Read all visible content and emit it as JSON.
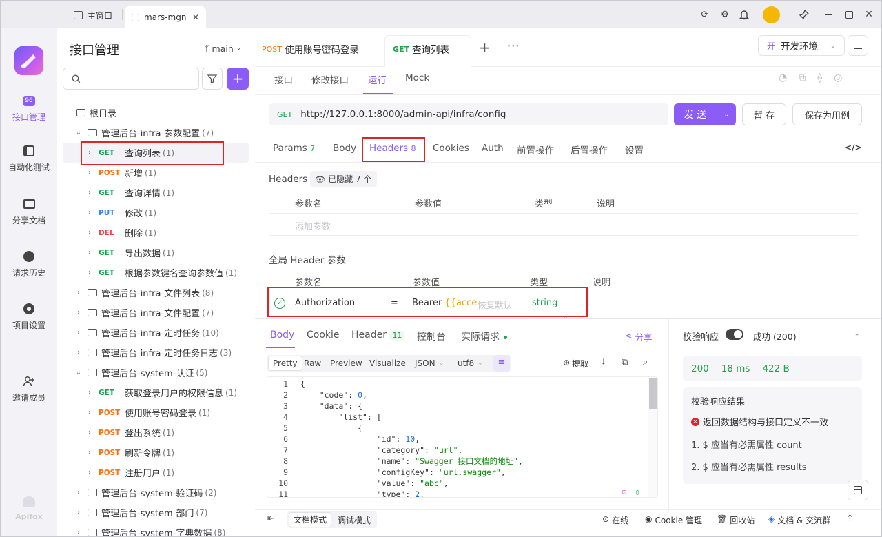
{
  "window": {
    "tabs": [
      {
        "label": "主窗口",
        "icon": "home-icon"
      },
      {
        "label": "mars-mgn",
        "icon": "external-icon",
        "close": "✕"
      }
    ]
  },
  "rail": {
    "items": [
      {
        "label": "接口管理",
        "icon": "api-icon",
        "active": true
      },
      {
        "label": "自动化测试",
        "icon": "automation-icon"
      },
      {
        "label": "分享文档",
        "icon": "book-icon"
      },
      {
        "label": "请求历史",
        "icon": "history-icon"
      },
      {
        "label": "项目设置",
        "icon": "settings-icon"
      },
      {
        "label": "邀请成员",
        "icon": "invite-icon"
      }
    ],
    "brand": "Apifox"
  },
  "tree": {
    "title": "接口管理",
    "branch": "main",
    "search_placeholder": "",
    "root": "根目录",
    "rows": [
      {
        "type": "folder",
        "label": "管理后台-infra-参数配置",
        "count": "(7)",
        "expanded": true,
        "indent": 0
      },
      {
        "type": "api",
        "method": "GET",
        "label": "查询列表",
        "count": "(1)",
        "selected": true
      },
      {
        "type": "api",
        "method": "POST",
        "label": "新增",
        "count": "(1)"
      },
      {
        "type": "api",
        "method": "GET",
        "label": "查询详情",
        "count": "(1)"
      },
      {
        "type": "api",
        "method": "PUT",
        "label": "修改",
        "count": "(1)"
      },
      {
        "type": "api",
        "method": "DEL",
        "label": "删除",
        "count": "(1)"
      },
      {
        "type": "api",
        "method": "GET",
        "label": "导出数据",
        "count": "(1)"
      },
      {
        "type": "api",
        "method": "GET",
        "label": "根据参数键名查询参数值",
        "count": "(1)"
      },
      {
        "type": "folder",
        "label": "管理后台-infra-文件列表",
        "count": "(8)"
      },
      {
        "type": "folder",
        "label": "管理后台-infra-文件配置",
        "count": "(7)"
      },
      {
        "type": "folder",
        "label": "管理后台-infra-定时任务",
        "count": "(10)"
      },
      {
        "type": "folder",
        "label": "管理后台-infra-定时任务日志",
        "count": "(3)"
      },
      {
        "type": "folder",
        "label": "管理后台-system-认证",
        "count": "(5)",
        "expanded": true
      },
      {
        "type": "api",
        "method": "GET",
        "label": "获取登录用户的权限信息",
        "count": "(1)"
      },
      {
        "type": "api",
        "method": "POST",
        "label": "使用账号密码登录",
        "count": "(1)"
      },
      {
        "type": "api",
        "method": "POST",
        "label": "登出系统",
        "count": "(1)"
      },
      {
        "type": "api",
        "method": "POST",
        "label": "刷新令牌",
        "count": "(1)"
      },
      {
        "type": "api",
        "method": "POST",
        "label": "注册用户",
        "count": "(1)"
      },
      {
        "type": "folder",
        "label": "管理后台-system-验证码",
        "count": "(2)"
      },
      {
        "type": "folder",
        "label": "管理后台-system-部门",
        "count": "(7)"
      },
      {
        "type": "folder",
        "label": "管理后台-system-字典数据",
        "count": "(8)"
      }
    ]
  },
  "doc_tabs": [
    {
      "method": "POST",
      "label": "使用账号密码登录"
    },
    {
      "method": "GET",
      "label": "查询列表",
      "active": true
    }
  ],
  "env": {
    "badge": "开",
    "label": "开发环境"
  },
  "sub_tabs": [
    "接口",
    "修改接口",
    "运行",
    "Mock"
  ],
  "sub_tab_active": "运行",
  "request": {
    "method": "GET",
    "url": "http://127.0.0.1:8000/admin-api/infra/config",
    "send": "发 送",
    "save": "暂 存",
    "save_case": "保存为用例"
  },
  "param_tabs": [
    {
      "label": "Params",
      "count": "7"
    },
    {
      "label": "Body"
    },
    {
      "label": "Headers",
      "count": "8",
      "active": true
    },
    {
      "label": "Cookies"
    },
    {
      "label": "Auth"
    },
    {
      "label": "前置操作"
    },
    {
      "label": "后置操作"
    },
    {
      "label": "设置"
    }
  ],
  "headers": {
    "section_label": "Headers",
    "hidden_badge": "已隐藏 7 个",
    "cols": [
      "参数名",
      "参数值",
      "类型",
      "说明"
    ],
    "add_placeholder": "添加参数",
    "global_label": "全局 Header 参数",
    "global_row": {
      "name": "Authorization",
      "eq": "=",
      "value_prefix": "Bearer ",
      "value_var": "{{acce",
      "restore": "恢复默认",
      "type": "string"
    }
  },
  "resp_tabs": [
    {
      "label": "Body",
      "active": true
    },
    {
      "label": "Cookie"
    },
    {
      "label": "Header",
      "count": "11"
    },
    {
      "label": "控制台"
    },
    {
      "label": "实际请求"
    }
  ],
  "share": "分享",
  "view_modes": [
    "Pretty",
    "Raw",
    "Preview",
    "Visualize"
  ],
  "format": "JSON",
  "encoding": "utf8",
  "extract": "提取",
  "code": [
    {
      "n": "1",
      "t": "{"
    },
    {
      "n": "2",
      "t": "    \"code\": 0,"
    },
    {
      "n": "3",
      "t": "    \"data\": {"
    },
    {
      "n": "4",
      "t": "        \"list\": ["
    },
    {
      "n": "5",
      "t": "            {"
    },
    {
      "n": "6",
      "t": "                \"id\": 10,"
    },
    {
      "n": "7",
      "t": "                \"category\": \"url\","
    },
    {
      "n": "8",
      "t": "                \"name\": \"Swagger 接口文档的地址\","
    },
    {
      "n": "9",
      "t": "                \"configKey\": \"url.swagger\","
    },
    {
      "n": "10",
      "t": "                \"value\": \"abc\","
    },
    {
      "n": "11",
      "t": "                \"type\": 2,"
    }
  ],
  "validation": {
    "label": "校验响应",
    "status": "成功 (200)",
    "code": "200",
    "time": "18 ms",
    "size": "422 B",
    "result_title": "校验响应结果",
    "error": "返回数据结构与接口定义不一致",
    "items": [
      "1. $ 应当有必需属性 count",
      "2. $ 应当有必需属性 results"
    ]
  },
  "footer": {
    "modes": [
      "文档模式",
      "调试模式"
    ],
    "online": "在线",
    "cookie": "Cookie 管理",
    "recycle": "回收站",
    "community": "文档 & 交流群"
  },
  "colors": {
    "accent": "#8b5cf6",
    "get": "#17a34a",
    "post": "#f97316",
    "put": "#3b82f6",
    "del": "#ef4444",
    "error": "#e02424"
  }
}
